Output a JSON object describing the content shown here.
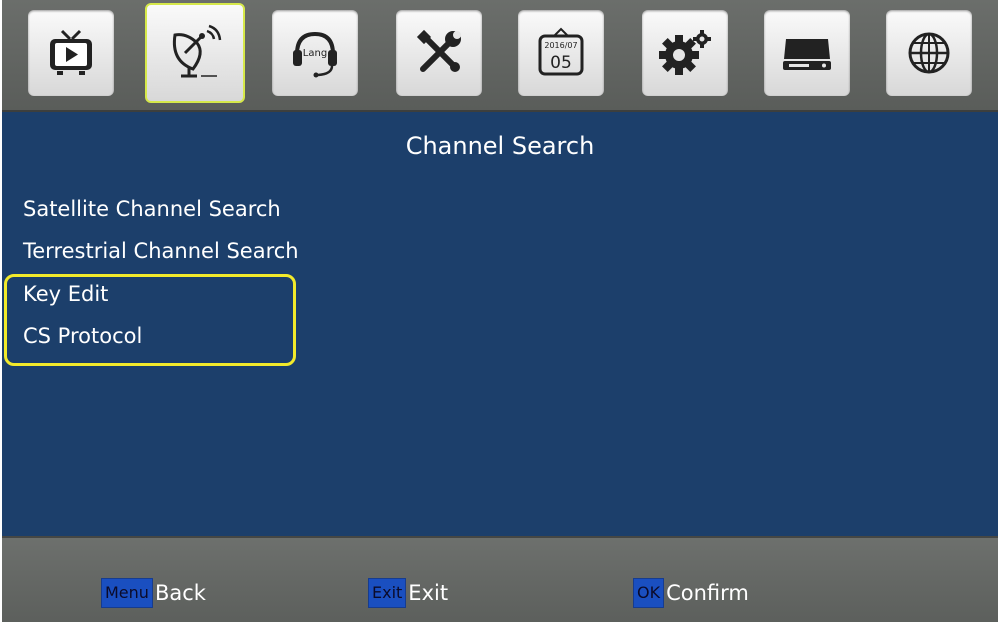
{
  "topbar": {
    "icons": [
      {
        "name": "tv-icon"
      },
      {
        "name": "satellite-dish-icon"
      },
      {
        "name": "language-headset-icon",
        "text": "Lang"
      },
      {
        "name": "tools-icon"
      },
      {
        "name": "calendar-icon",
        "month_text": "2016/07",
        "day_text": "05"
      },
      {
        "name": "settings-gears-icon"
      },
      {
        "name": "storage-drive-icon"
      },
      {
        "name": "globe-icon"
      }
    ],
    "selected_index": 1,
    "highlight_color": "#d6e84a"
  },
  "page": {
    "title": "Channel Search",
    "background_color": "#1c3f6b"
  },
  "menu": {
    "items": [
      {
        "label": "Satellite Channel Search"
      },
      {
        "label": "Terrestrial Channel Search"
      },
      {
        "label": "Key Edit"
      },
      {
        "label": "CS Protocol"
      }
    ],
    "highlight_color": "#f2ea2b"
  },
  "footer": {
    "hints": [
      {
        "key": "Menu",
        "label": "Back"
      },
      {
        "key": "Exit",
        "label": "Exit"
      },
      {
        "key": "OK",
        "label": "Confirm"
      }
    ],
    "key_color": "#1a4fc0"
  }
}
